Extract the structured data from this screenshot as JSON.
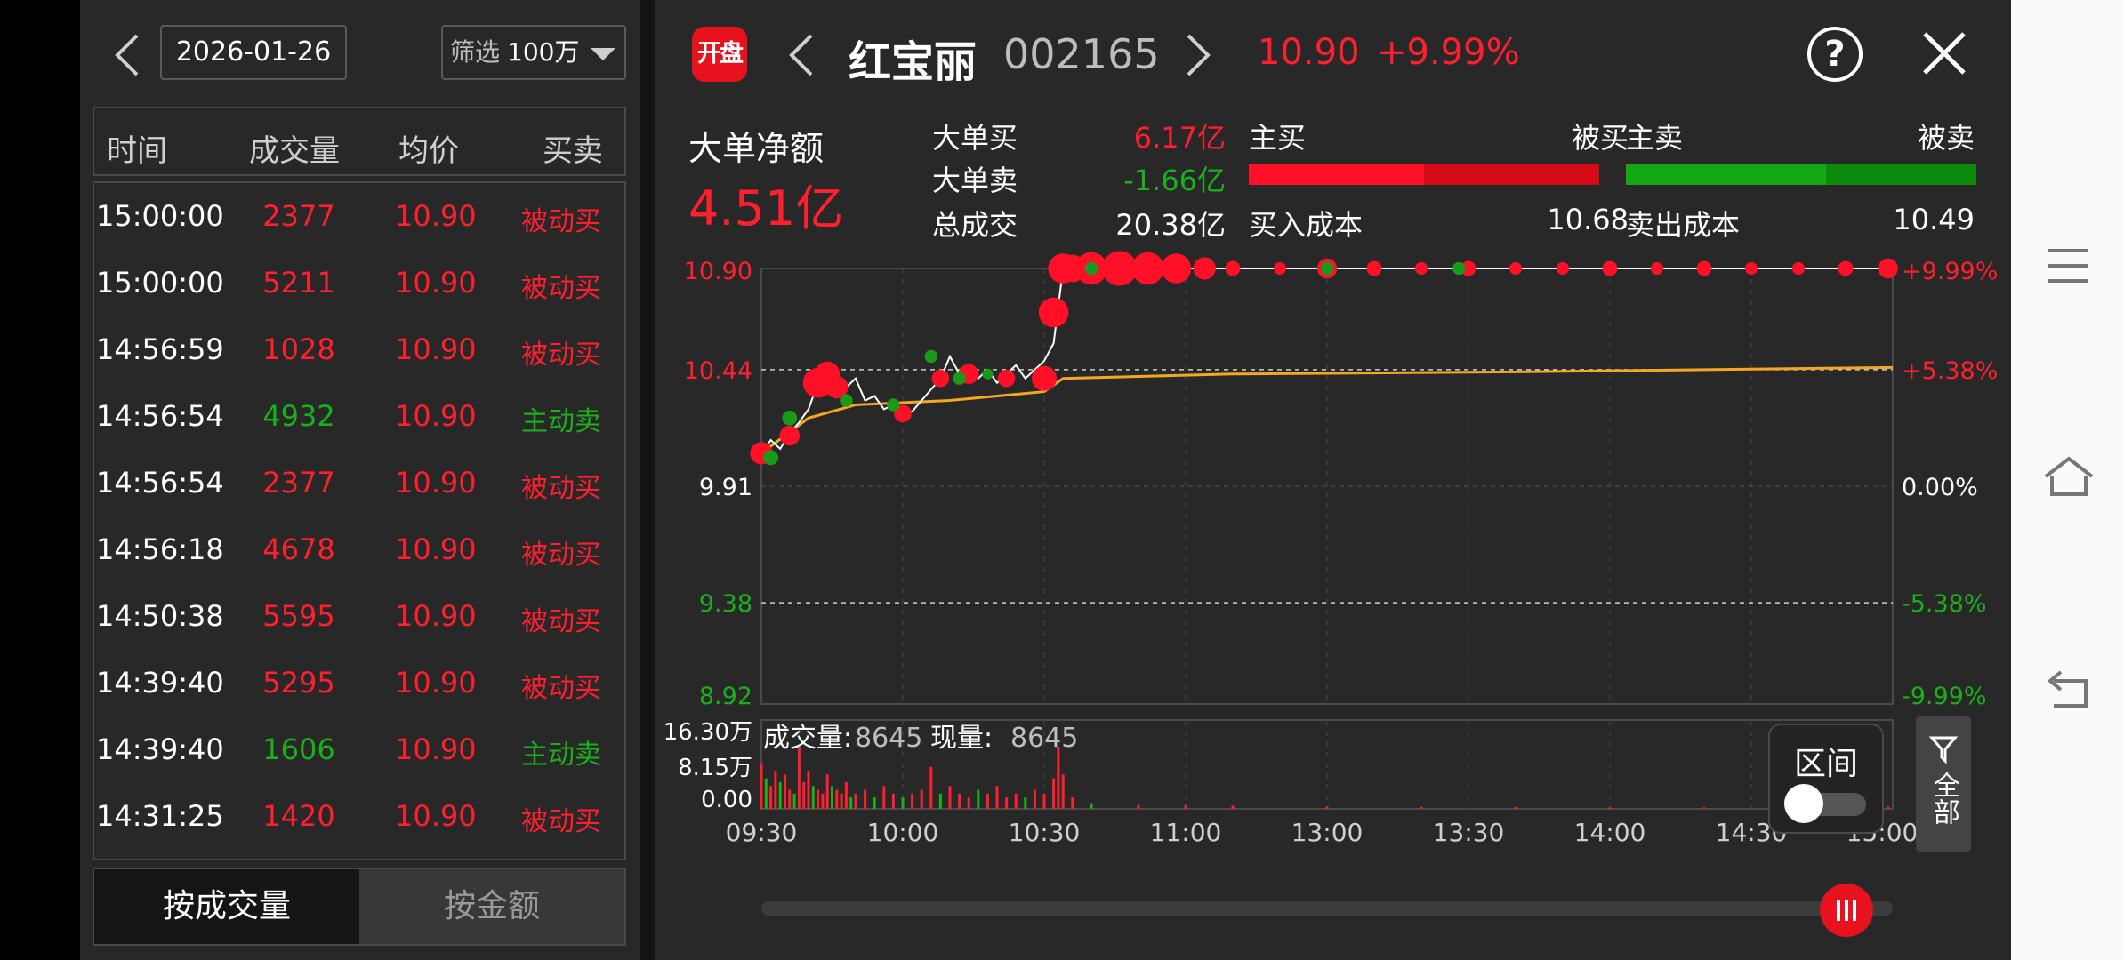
{
  "left": {
    "date": "2026-01-26",
    "filter_label": "筛选",
    "filter_value": "100万",
    "headers": {
      "time": "时间",
      "volume": "成交量",
      "avg": "均价",
      "side": "买卖"
    },
    "rows": [
      {
        "time": "15:00:00",
        "volume": "2377",
        "price": "10.90",
        "side": "被动买",
        "color": "red"
      },
      {
        "time": "15:00:00",
        "volume": "5211",
        "price": "10.90",
        "side": "被动买",
        "color": "red"
      },
      {
        "time": "14:56:59",
        "volume": "1028",
        "price": "10.90",
        "side": "被动买",
        "color": "red"
      },
      {
        "time": "14:56:54",
        "volume": "4932",
        "price": "10.90",
        "side": "主动卖",
        "color": "green"
      },
      {
        "time": "14:56:54",
        "volume": "2377",
        "price": "10.90",
        "side": "被动买",
        "color": "red"
      },
      {
        "time": "14:56:18",
        "volume": "4678",
        "price": "10.90",
        "side": "被动买",
        "color": "red"
      },
      {
        "time": "14:50:38",
        "volume": "5595",
        "price": "10.90",
        "side": "被动买",
        "color": "red"
      },
      {
        "time": "14:39:40",
        "volume": "5295",
        "price": "10.90",
        "side": "被动买",
        "color": "red"
      },
      {
        "time": "14:39:40",
        "volume": "1606",
        "price": "10.90",
        "side": "主动卖",
        "color": "green"
      },
      {
        "time": "14:31:25",
        "volume": "1420",
        "price": "10.90",
        "side": "被动买",
        "color": "red"
      }
    ],
    "tab_volume": "按成交量",
    "tab_amount": "按金额"
  },
  "header": {
    "logo": "开盘",
    "name": "红宝丽",
    "code": "002165",
    "price": "10.90",
    "change": "+9.99%"
  },
  "stats": {
    "net_label": "大单净额",
    "net_value": "4.51亿",
    "big_buy_label": "大单买",
    "big_buy_value": "6.17亿",
    "big_sell_label": "大单卖",
    "big_sell_value": "-1.66亿",
    "total_label": "总成交",
    "total_value": "20.38亿",
    "active_buy": "主买",
    "passive_buy": "被买",
    "active_sell": "主卖",
    "passive_sell": "被卖",
    "buy_cost_label": "买入成本",
    "buy_cost_value": "10.68",
    "sell_cost_label": "卖出成本",
    "sell_cost_value": "10.49",
    "buy_bar_active_fraction": 0.5,
    "sell_bar_active_fraction": 0.57
  },
  "chart": {
    "price_ticks": [
      "10.90",
      "10.44",
      "9.91",
      "9.38",
      "8.92"
    ],
    "pct_ticks": [
      "+9.99%",
      "+5.38%",
      "0.00%",
      "-5.38%",
      "-9.99%"
    ],
    "vol_ticks": [
      "16.30万",
      "8.15万",
      "0.00"
    ],
    "time_ticks": [
      "09:30",
      "10:00",
      "10:30",
      "11:00",
      "13:00",
      "13:30",
      "14:00",
      "14:30",
      "15:00"
    ],
    "vol_label": "成交量:",
    "vol_value": "8645",
    "cur_label": "现量:",
    "cur_value": "8645",
    "range_label": "区间",
    "filter_all": "全部"
  },
  "chart_data": {
    "type": "line",
    "ylim": [
      8.92,
      10.9
    ],
    "prev_close": 9.91,
    "x_minutes_range": [
      0,
      240
    ],
    "price_series": [
      [
        0,
        10.06
      ],
      [
        2,
        10.12
      ],
      [
        4,
        10.08
      ],
      [
        6,
        10.15
      ],
      [
        8,
        10.2
      ],
      [
        10,
        10.26
      ],
      [
        12,
        10.38
      ],
      [
        14,
        10.34
      ],
      [
        16,
        10.41
      ],
      [
        18,
        10.36
      ],
      [
        20,
        10.4
      ],
      [
        22,
        10.3
      ],
      [
        24,
        10.32
      ],
      [
        26,
        10.26
      ],
      [
        28,
        10.28
      ],
      [
        30,
        10.24
      ],
      [
        32,
        10.25
      ],
      [
        34,
        10.3
      ],
      [
        36,
        10.35
      ],
      [
        38,
        10.4
      ],
      [
        40,
        10.5
      ],
      [
        42,
        10.42
      ],
      [
        44,
        10.46
      ],
      [
        46,
        10.4
      ],
      [
        48,
        10.44
      ],
      [
        50,
        10.38
      ],
      [
        52,
        10.42
      ],
      [
        54,
        10.46
      ],
      [
        56,
        10.4
      ],
      [
        58,
        10.44
      ],
      [
        60,
        10.48
      ],
      [
        62,
        10.56
      ],
      [
        64,
        10.9
      ],
      [
        240,
        10.9
      ]
    ],
    "avg_series": [
      [
        0,
        10.06
      ],
      [
        10,
        10.22
      ],
      [
        20,
        10.28
      ],
      [
        40,
        10.3
      ],
      [
        60,
        10.34
      ],
      [
        64,
        10.4
      ],
      [
        100,
        10.42
      ],
      [
        160,
        10.43
      ],
      [
        240,
        10.45
      ]
    ],
    "big_orders_red": [
      [
        0,
        10.06,
        9
      ],
      [
        6,
        10.14,
        8
      ],
      [
        12,
        10.38,
        12
      ],
      [
        14,
        10.42,
        10
      ],
      [
        16,
        10.36,
        9
      ],
      [
        30,
        10.24,
        7
      ],
      [
        38,
        10.4,
        7
      ],
      [
        44,
        10.42,
        8
      ],
      [
        52,
        10.4,
        7
      ],
      [
        60,
        10.4,
        10
      ],
      [
        62,
        10.7,
        12
      ],
      [
        64,
        10.9,
        12
      ],
      [
        66,
        10.9,
        11
      ],
      [
        70,
        10.9,
        13
      ],
      [
        76,
        10.9,
        14
      ],
      [
        82,
        10.9,
        13
      ],
      [
        88,
        10.9,
        12
      ],
      [
        94,
        10.9,
        9
      ],
      [
        100,
        10.9,
        6
      ],
      [
        110,
        10.9,
        5
      ],
      [
        120,
        10.9,
        8
      ],
      [
        130,
        10.9,
        6
      ],
      [
        140,
        10.9,
        5
      ],
      [
        150,
        10.9,
        6
      ],
      [
        160,
        10.9,
        5
      ],
      [
        170,
        10.9,
        5
      ],
      [
        180,
        10.9,
        6
      ],
      [
        190,
        10.9,
        5
      ],
      [
        200,
        10.9,
        6
      ],
      [
        210,
        10.9,
        5
      ],
      [
        220,
        10.9,
        5
      ],
      [
        230,
        10.9,
        6
      ],
      [
        239,
        10.9,
        8
      ]
    ],
    "big_orders_green": [
      [
        2,
        10.04,
        7
      ],
      [
        6,
        10.22,
        7
      ],
      [
        18,
        10.3,
        6
      ],
      [
        28,
        10.28,
        6
      ],
      [
        36,
        10.5,
        6
      ],
      [
        42,
        10.4,
        6
      ],
      [
        48,
        10.42,
        5
      ],
      [
        70,
        10.9,
        6
      ],
      [
        120,
        10.9,
        6
      ],
      [
        148,
        10.9,
        6
      ]
    ],
    "volume_bars": [
      [
        0,
        12,
        "r"
      ],
      [
        1,
        8,
        "g"
      ],
      [
        2,
        6,
        "r"
      ],
      [
        3,
        10,
        "r"
      ],
      [
        4,
        7,
        "g"
      ],
      [
        5,
        9,
        "r"
      ],
      [
        6,
        5,
        "r"
      ],
      [
        7,
        4,
        "g"
      ],
      [
        8,
        16.3,
        "r"
      ],
      [
        9,
        7,
        "r"
      ],
      [
        10,
        10,
        "r"
      ],
      [
        11,
        6,
        "g"
      ],
      [
        12,
        5,
        "r"
      ],
      [
        13,
        4,
        "r"
      ],
      [
        14,
        9,
        "r"
      ],
      [
        15,
        6,
        "g"
      ],
      [
        16,
        5,
        "r"
      ],
      [
        17,
        4,
        "r"
      ],
      [
        18,
        7,
        "r"
      ],
      [
        19,
        3,
        "g"
      ],
      [
        20,
        4,
        "r"
      ],
      [
        22,
        5,
        "r"
      ],
      [
        24,
        3,
        "g"
      ],
      [
        26,
        6,
        "r"
      ],
      [
        28,
        4,
        "r"
      ],
      [
        30,
        3,
        "g"
      ],
      [
        32,
        4,
        "r"
      ],
      [
        34,
        5,
        "r"
      ],
      [
        36,
        11,
        "r"
      ],
      [
        38,
        4,
        "g"
      ],
      [
        40,
        6,
        "r"
      ],
      [
        42,
        4,
        "r"
      ],
      [
        44,
        3,
        "r"
      ],
      [
        46,
        5,
        "g"
      ],
      [
        48,
        4,
        "r"
      ],
      [
        50,
        6,
        "r"
      ],
      [
        52,
        3,
        "r"
      ],
      [
        54,
        4,
        "r"
      ],
      [
        56,
        3,
        "g"
      ],
      [
        58,
        5,
        "r"
      ],
      [
        60,
        4,
        "r"
      ],
      [
        62,
        8,
        "r"
      ],
      [
        63,
        16.3,
        "r"
      ],
      [
        64,
        9,
        "r"
      ],
      [
        66,
        3,
        "r"
      ],
      [
        70,
        1.5,
        "g"
      ],
      [
        80,
        1,
        "r"
      ],
      [
        90,
        1,
        "r"
      ],
      [
        100,
        0.8,
        "r"
      ],
      [
        120,
        0.6,
        "r"
      ],
      [
        140,
        0.5,
        "r"
      ],
      [
        160,
        0.5,
        "r"
      ],
      [
        180,
        0.4,
        "r"
      ],
      [
        200,
        0.4,
        "r"
      ],
      [
        220,
        0.4,
        "r"
      ],
      [
        239,
        0.6,
        "r"
      ]
    ]
  },
  "nav": {
    "menu": "menu-icon",
    "home": "home-icon",
    "back": "back-icon"
  },
  "colors": {
    "up": "#ff1f2e",
    "down": "#1ab01a",
    "avg": "#f5a623",
    "bg": "#282828"
  }
}
